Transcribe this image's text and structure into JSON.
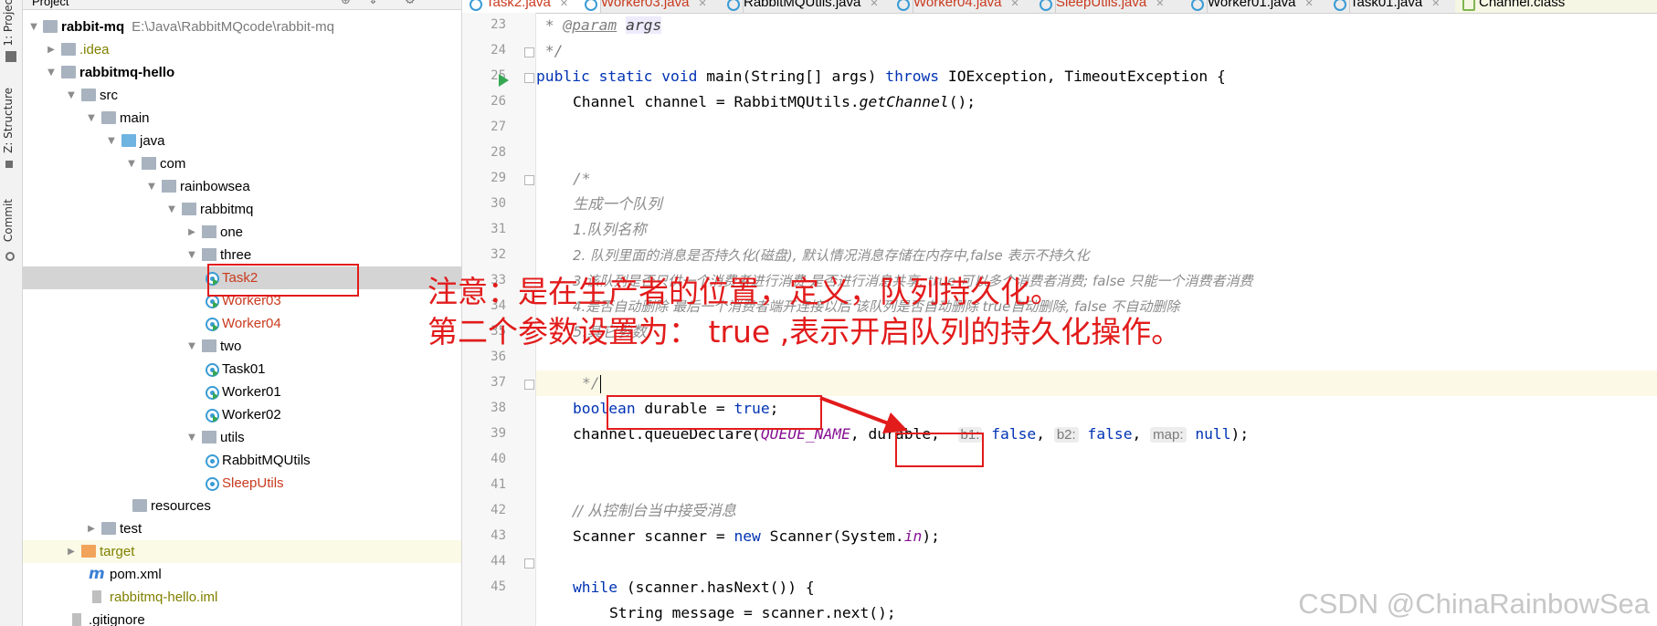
{
  "tool_strip": {
    "tabs": [
      "1: Project",
      "Z: Structure",
      "Commit"
    ]
  },
  "project": {
    "header": "Project",
    "root": {
      "name": "rabbit-mq",
      "path": "E:\\Java\\RabbitMQcode\\rabbit-mq"
    },
    "items": [
      {
        "label": ".idea"
      },
      {
        "label": "rabbitmq-hello"
      },
      {
        "label": "src"
      },
      {
        "label": "main"
      },
      {
        "label": "java"
      },
      {
        "label": "com"
      },
      {
        "label": "rainbowsea"
      },
      {
        "label": "rabbitmq"
      },
      {
        "label": "one"
      },
      {
        "label": "three"
      },
      {
        "label": "Task2"
      },
      {
        "label": "Worker03"
      },
      {
        "label": "Worker04"
      },
      {
        "label": "two"
      },
      {
        "label": "Task01"
      },
      {
        "label": "Worker01"
      },
      {
        "label": "Worker02"
      },
      {
        "label": "utils"
      },
      {
        "label": "RabbitMQUtils"
      },
      {
        "label": "SleepUtils"
      },
      {
        "label": "resources"
      },
      {
        "label": "test"
      },
      {
        "label": "target"
      },
      {
        "label": "pom.xml"
      },
      {
        "label": "rabbitmq-hello.iml"
      },
      {
        "label": ".gitignore"
      }
    ]
  },
  "editor": {
    "tabs": [
      "Task2.java",
      "Worker03.java",
      "RabbitMQUtils.java",
      "Worker04.java",
      "SleepUtils.java",
      "Worker01.java",
      "Task01.java",
      "Channel.class"
    ],
    "line_numbers": [
      "23",
      "24",
      "25",
      "26",
      "27",
      "28",
      "29",
      "30",
      "31",
      "32",
      "33",
      "34",
      "35",
      "36",
      "37",
      "38",
      "39",
      "40",
      "41",
      "42",
      "43",
      "44",
      "45"
    ],
    "code": {
      "l23_a": " * ",
      "l23_b": "@param",
      "l23_c": "args",
      "l24": " */",
      "l25_a": "public static void ",
      "l25_b": "main(String[] args) ",
      "l25_c": "throws",
      "l25_d": " IOException, TimeoutException {",
      "l26_a": "Channel channel = RabbitMQUtils.",
      "l26_b": "getChannel",
      "l26_c": "();",
      "l29": "/*",
      "l30": "生成一个队列",
      "l31": "1.队列名称",
      "l32": "2. 队列里面的消息是否持久化(磁盘), 默认情况消息存储在内存中,false 表示不持久化",
      "l33": "3.该队列是否只供一个消费者进行消费 是否进行消息共享, true 可以多个消费者消费; false 只能一个消费者消费",
      "l34": "4.是否自动删除 最后一个消费者端开连接以后 该队列是否自动删除 true自动删除, false 不自动删除",
      "l35": "5.其它参数",
      "l37": "*/",
      "l38_a": "boolean",
      "l38_b": " durable = ",
      "l38_c": "true",
      "l38_d": ";",
      "l39_a": "channel.queueDeclare(",
      "l39_b": "QUEUE_NAME",
      "l39_c": ", ",
      "l39_d": "durable",
      "l39_e": ",",
      "hint_b1": "b1:",
      "l39_f": "false",
      "hint_b2": "b2:",
      "l39_g": "false",
      "hint_map": "map:",
      "l39_h": "null",
      "l39_i": ");",
      "l41": "// 从控制台当中接受消息",
      "l42_a": "Scanner scanner = ",
      "l42_b": "new",
      "l42_c": " Scanner(System.",
      "l42_d": "in",
      "l42_e": ");",
      "l44_a": "while",
      "l44_b": " (scanner.hasNext()) {",
      "l45": "String message = scanner.next();"
    }
  },
  "annotation": {
    "line1": "注意：是在生产者的位置，定义，队列持久化。",
    "line2": "第二个参数设置为：  true ,表示开启队列的持久化操作。"
  },
  "watermark": "CSDN @ChinaRainbowSea",
  "colors": {
    "annotation_red": "#e21b1b",
    "keyword_blue": "#0033b3",
    "comment_gray": "#8c8c8c"
  }
}
